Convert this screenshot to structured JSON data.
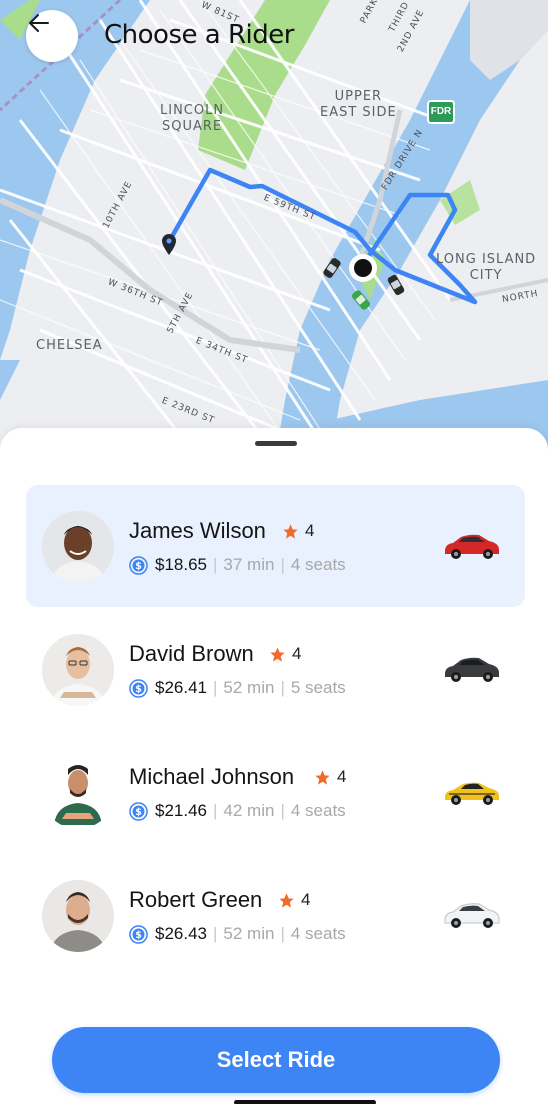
{
  "header": {
    "title": "Choose a Rider"
  },
  "map": {
    "places": {
      "lincoln_line1": "LINCOLN",
      "lincoln_line2": "SQUARE",
      "upper_line1": "UPPER",
      "upper_line2": "EAST SIDE",
      "long_line1": "LONG ISLAND",
      "long_line2": "CITY",
      "chelsea": "CHELSEA"
    },
    "streets": {
      "w81": "W 81ST",
      "park": "PARK",
      "third": "THIRD",
      "second": "2ND AVE",
      "fdr_drive": "FDR DRIVE N",
      "e59": "E 59TH ST",
      "tenth": "10TH AVE",
      "w36": "W 36TH ST",
      "fifth": "5TH AVE",
      "e34": "E 34TH ST",
      "e23": "E 23RD ST",
      "north": "NORTH"
    },
    "fdr_badge": "FDR",
    "colors": {
      "route": "#3d84f4",
      "park": "#a9dc8b",
      "water": "#9cc7ef"
    }
  },
  "riders": [
    {
      "name": "James Wilson",
      "rating": "4",
      "price": "$18.65",
      "time": "37 min",
      "seats": "4 seats",
      "car_color": "#d42828",
      "selected": true
    },
    {
      "name": "David Brown",
      "rating": "4",
      "price": "$26.41",
      "time": "52 min",
      "seats": "5 seats",
      "car_color": "#3a3b3e",
      "selected": false
    },
    {
      "name": "Michael Johnson",
      "rating": "4",
      "price": "$21.46",
      "time": "42 min",
      "seats": "4 seats",
      "car_color": "#f1c21b",
      "selected": false
    },
    {
      "name": "Robert Green",
      "rating": "4",
      "price": "$26.43",
      "time": "52 min",
      "seats": "4 seats",
      "car_color": "#f2f3f5",
      "selected": false
    }
  ],
  "separator": "|",
  "cta": {
    "label": "Select Ride",
    "color": "#3d84f4"
  }
}
